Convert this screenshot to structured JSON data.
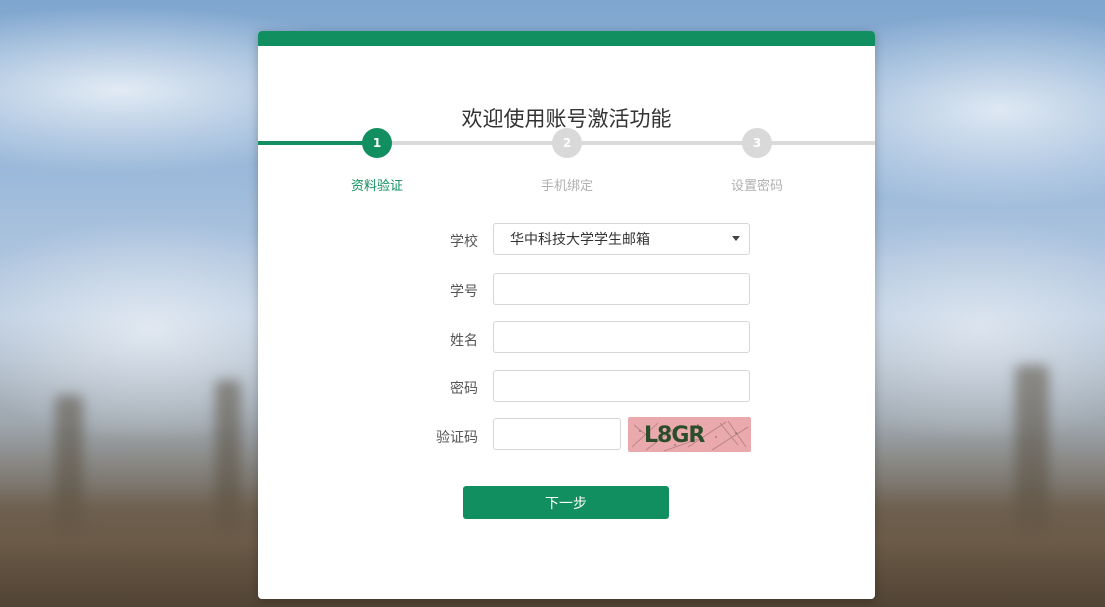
{
  "colors": {
    "accent": "#128f60",
    "inactive_step": "#d9d9d9",
    "inactive_text": "#b0b0b0",
    "captcha_bg": "#e9a9ad",
    "captcha_text": "#2b4d2a"
  },
  "page": {
    "title": "欢迎使用账号激活功能"
  },
  "steps": [
    {
      "number": "1",
      "label": "资料验证",
      "state": "active"
    },
    {
      "number": "2",
      "label": "手机绑定",
      "state": "inactive"
    },
    {
      "number": "3",
      "label": "设置密码",
      "state": "inactive"
    }
  ],
  "form": {
    "school": {
      "label": "学校",
      "selected": "华中科技大学学生邮箱",
      "icon": "chevron-down-icon"
    },
    "student_id": {
      "label": "学号",
      "value": "",
      "placeholder": ""
    },
    "name": {
      "label": "姓名",
      "value": "",
      "placeholder": ""
    },
    "password": {
      "label": "密码",
      "value": "",
      "placeholder": ""
    },
    "captcha": {
      "label": "验证码",
      "value": "",
      "placeholder": "",
      "image_text": "L8GR"
    }
  },
  "actions": {
    "next_label": "下一步"
  }
}
